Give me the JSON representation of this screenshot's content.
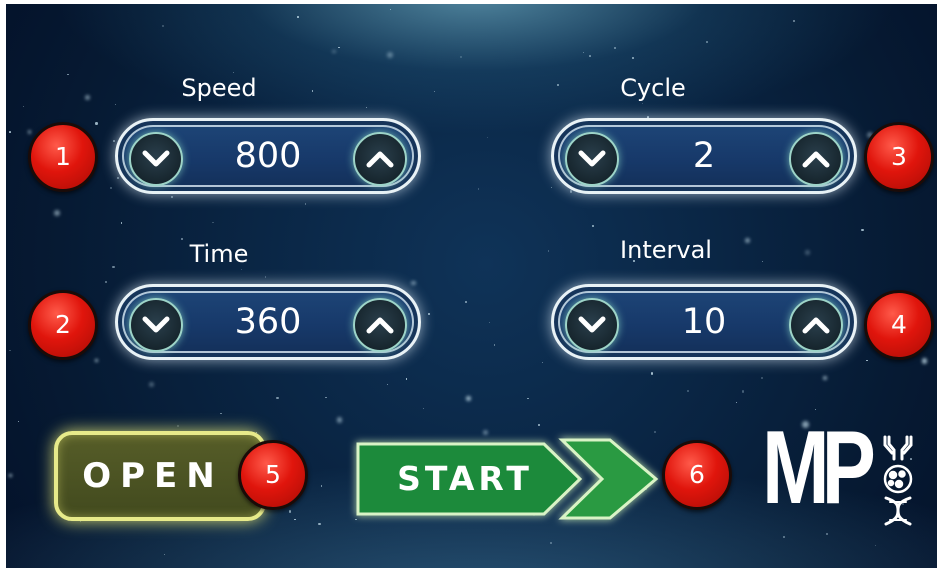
{
  "controls": {
    "speed": {
      "label": "Speed",
      "value": "800",
      "badge": "1"
    },
    "time": {
      "label": "Time",
      "value": "360",
      "badge": "2"
    },
    "cycle": {
      "label": "Cycle",
      "value": "2",
      "badge": "3"
    },
    "interval": {
      "label": "Interval",
      "value": "10",
      "badge": "4"
    }
  },
  "actions": {
    "open_label": "OPEN",
    "open_badge": "5",
    "start_label": "START",
    "start_badge": "6"
  },
  "logo": {
    "text": "MP"
  },
  "icons": {
    "decrement": "chevron-down-icon",
    "increment": "chevron-up-icon",
    "start_arrow": "double-chevron-right-icon",
    "logo_icons": [
      "antibody-icon",
      "cell-icon",
      "dna-icon"
    ]
  },
  "colors": {
    "background": "#0a2645",
    "stepper_fill": "#1e4678",
    "badge_red": "#e0150c",
    "open_border": "#e7ea8a",
    "start_green": "#1f8a3a"
  }
}
